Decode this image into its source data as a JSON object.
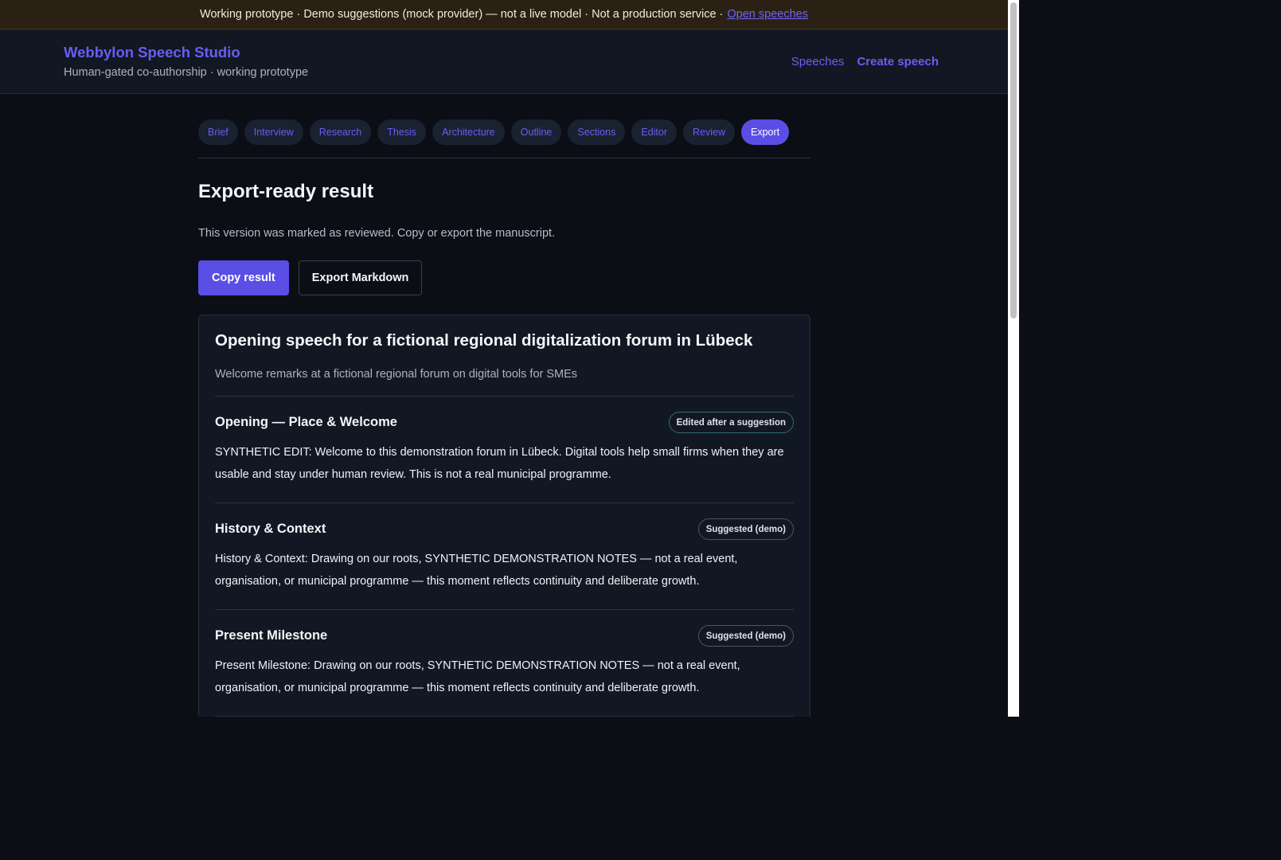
{
  "banner": {
    "text": "Working prototype · Demo suggestions (mock provider) — not a live model · Not a production service ·",
    "link": "Open speeches"
  },
  "header": {
    "title": "Webbylon Speech Studio",
    "subtitle": "Human-gated co-authorship · working prototype",
    "nav": [
      "Speeches",
      "Create speech"
    ]
  },
  "steps": [
    "Brief",
    "Interview",
    "Research",
    "Thesis",
    "Architecture",
    "Outline",
    "Sections",
    "Editor",
    "Review",
    "Export"
  ],
  "active_step": "Export",
  "page": {
    "title": "Export-ready result",
    "description": "This version was marked as reviewed. Copy or export the manuscript.",
    "copy_label": "Copy result",
    "export_label": "Export Markdown"
  },
  "manuscript": {
    "title": "Opening speech for a fictional regional digitalization forum in Lübeck",
    "subtitle": "Welcome remarks at a fictional regional forum on digital tools for SMEs",
    "sections": [
      {
        "title": "Opening — Place & Welcome",
        "badge": "Edited after a suggestion",
        "body": "SYNTHETIC EDIT: Welcome to this demonstration forum in Lübeck. Digital tools help small firms when they are usable and stay under human review. This is not a real municipal programme."
      },
      {
        "title": "History & Context",
        "badge": "Suggested (demo)",
        "body": "History & Context: Drawing on our roots, SYNTHETIC DEMONSTRATION NOTES — not a real event, organisation, or municipal programme — this moment reflects continuity and deliberate growth."
      },
      {
        "title": "Present Milestone",
        "badge": "Suggested (demo)",
        "body": "Present Milestone: Drawing on our roots, SYNTHETIC DEMONSTRATION NOTES — not a real event, organisation, or municipal programme — this moment reflects continuity and deliberate growth."
      }
    ]
  }
}
